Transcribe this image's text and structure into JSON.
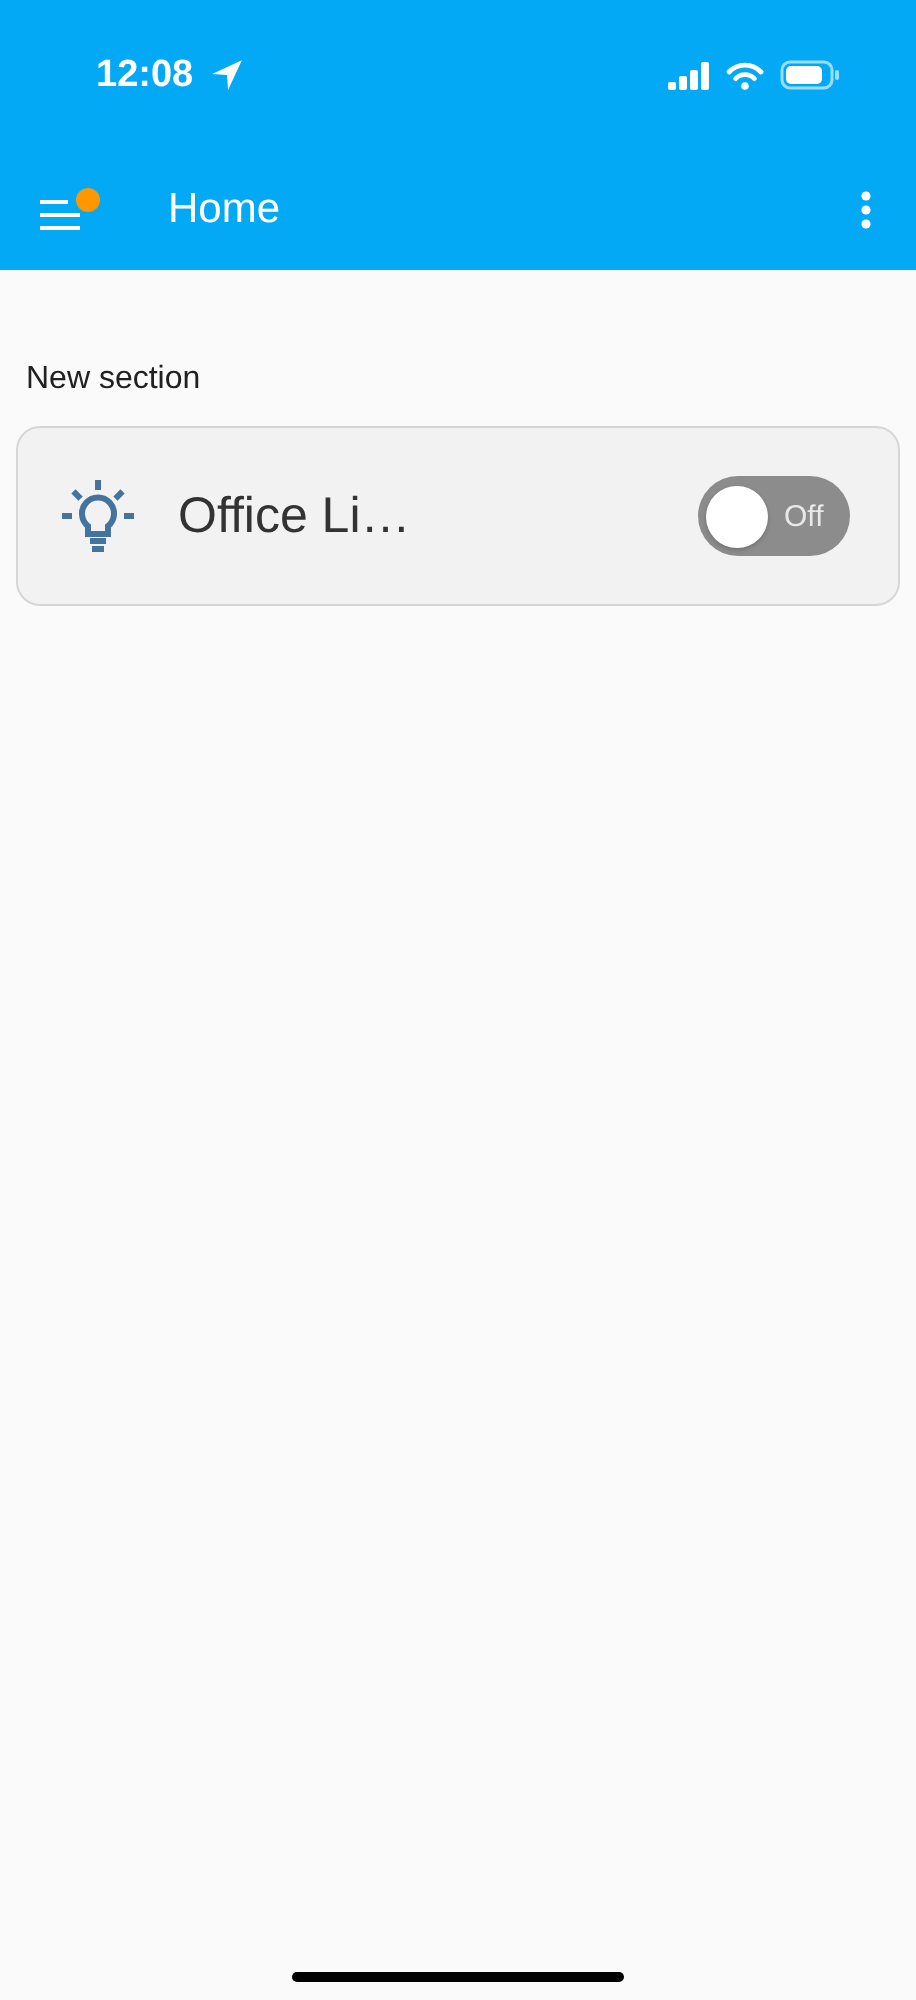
{
  "status_bar": {
    "time": "12:08"
  },
  "app_bar": {
    "title": "Home",
    "notification": true
  },
  "sections": [
    {
      "title": "New section",
      "cards": [
        {
          "kind": "light",
          "name": "Office Li…",
          "on": false,
          "state_label": "Off"
        }
      ]
    }
  ]
}
